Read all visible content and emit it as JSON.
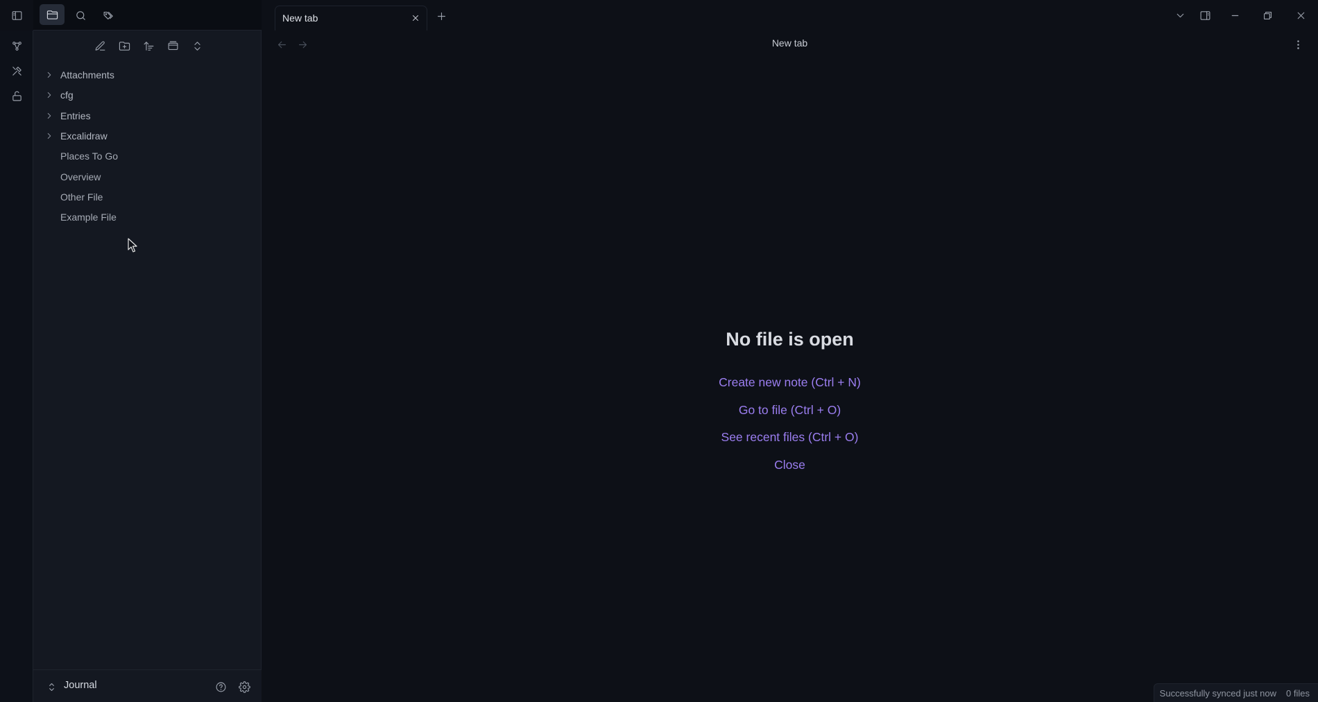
{
  "tabs": [
    {
      "title": "New tab",
      "active": true
    }
  ],
  "nav_title": "New tab",
  "sidebar": {
    "tree": [
      {
        "label": "Attachments",
        "type": "folder"
      },
      {
        "label": "cfg",
        "type": "folder"
      },
      {
        "label": "Entries",
        "type": "folder"
      },
      {
        "label": "Excalidraw",
        "type": "folder"
      },
      {
        "label": "Places To Go",
        "type": "file"
      },
      {
        "label": "Overview",
        "type": "file"
      },
      {
        "label": "Other File",
        "type": "file"
      },
      {
        "label": "Example File",
        "type": "file"
      }
    ],
    "vault_name": "Journal"
  },
  "empty_state": {
    "title": "No file is open",
    "links": [
      "Create new note (Ctrl + N)",
      "Go to file (Ctrl + O)",
      "See recent files (Ctrl + O)",
      "Close"
    ]
  },
  "status": {
    "sync": "Successfully synced just now",
    "files": "0 files"
  },
  "colors": {
    "accent": "#9b7ef0",
    "background": "#0d1017",
    "sidebar": "#141821"
  },
  "icons": {
    "ribbon": [
      "graph-icon",
      "excalidraw-icon",
      "lock-icon"
    ],
    "titlebar_left": [
      "sidebar-toggle-icon",
      "folder-icon",
      "search-icon",
      "tags-icon"
    ],
    "titlebar_right": [
      "chevron-down-icon",
      "right-sidebar-icon",
      "minimize-icon",
      "restore-icon",
      "close-icon"
    ],
    "file_toolbar": [
      "new-note-icon",
      "new-folder-icon",
      "sort-icon",
      "collapse-view-icon",
      "expand-collapse-icon"
    ]
  }
}
